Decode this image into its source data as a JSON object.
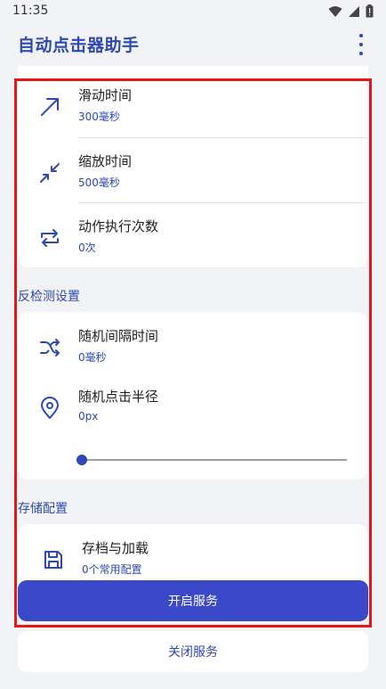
{
  "status_bar": {
    "time": "11:35"
  },
  "app_bar": {
    "title": "自动点击器助手"
  },
  "timing_card": {
    "items": [
      {
        "icon": "swipe-arrow-icon",
        "title": "滑动时间",
        "value": "300毫秒"
      },
      {
        "icon": "pinch-zoom-icon",
        "title": "缩放时间",
        "value": "500毫秒"
      },
      {
        "icon": "repeat-icon",
        "title": "动作执行次数",
        "value": "0次"
      }
    ]
  },
  "anti_detection": {
    "section_title": "反检测设置",
    "items": [
      {
        "icon": "shuffle-icon",
        "title": "随机间隔时间",
        "value": "0毫秒"
      },
      {
        "icon": "location-pin-icon",
        "title": "随机点击半径",
        "value": "0px"
      }
    ],
    "radius_slider_fraction": 0
  },
  "storage": {
    "section_title": "存储配置",
    "items": [
      {
        "icon": "save-icon",
        "title": "存档与加载",
        "value": "0个常用配置"
      }
    ]
  },
  "buttons": {
    "start": "开启服务",
    "stop": "关闭服务"
  },
  "colors": {
    "accent": "#2f48b5",
    "button": "#3949c8",
    "highlight_frame": "#e11919"
  }
}
